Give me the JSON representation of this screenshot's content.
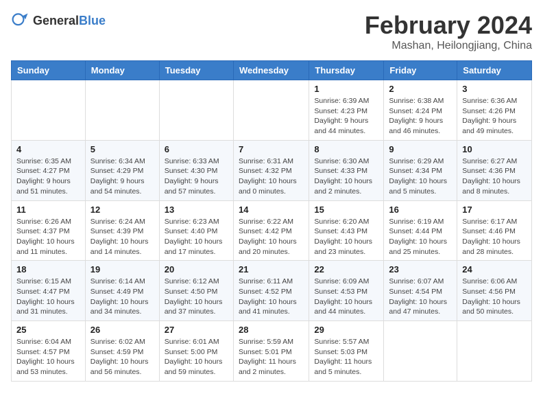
{
  "header": {
    "logo_general": "General",
    "logo_blue": "Blue",
    "month_title": "February 2024",
    "location": "Mashan, Heilongjiang, China"
  },
  "weekdays": [
    "Sunday",
    "Monday",
    "Tuesday",
    "Wednesday",
    "Thursday",
    "Friday",
    "Saturday"
  ],
  "weeks": [
    [
      {
        "day": "",
        "info": ""
      },
      {
        "day": "",
        "info": ""
      },
      {
        "day": "",
        "info": ""
      },
      {
        "day": "",
        "info": ""
      },
      {
        "day": "1",
        "info": "Sunrise: 6:39 AM\nSunset: 4:23 PM\nDaylight: 9 hours\nand 44 minutes."
      },
      {
        "day": "2",
        "info": "Sunrise: 6:38 AM\nSunset: 4:24 PM\nDaylight: 9 hours\nand 46 minutes."
      },
      {
        "day": "3",
        "info": "Sunrise: 6:36 AM\nSunset: 4:26 PM\nDaylight: 9 hours\nand 49 minutes."
      }
    ],
    [
      {
        "day": "4",
        "info": "Sunrise: 6:35 AM\nSunset: 4:27 PM\nDaylight: 9 hours\nand 51 minutes."
      },
      {
        "day": "5",
        "info": "Sunrise: 6:34 AM\nSunset: 4:29 PM\nDaylight: 9 hours\nand 54 minutes."
      },
      {
        "day": "6",
        "info": "Sunrise: 6:33 AM\nSunset: 4:30 PM\nDaylight: 9 hours\nand 57 minutes."
      },
      {
        "day": "7",
        "info": "Sunrise: 6:31 AM\nSunset: 4:32 PM\nDaylight: 10 hours\nand 0 minutes."
      },
      {
        "day": "8",
        "info": "Sunrise: 6:30 AM\nSunset: 4:33 PM\nDaylight: 10 hours\nand 2 minutes."
      },
      {
        "day": "9",
        "info": "Sunrise: 6:29 AM\nSunset: 4:34 PM\nDaylight: 10 hours\nand 5 minutes."
      },
      {
        "day": "10",
        "info": "Sunrise: 6:27 AM\nSunset: 4:36 PM\nDaylight: 10 hours\nand 8 minutes."
      }
    ],
    [
      {
        "day": "11",
        "info": "Sunrise: 6:26 AM\nSunset: 4:37 PM\nDaylight: 10 hours\nand 11 minutes."
      },
      {
        "day": "12",
        "info": "Sunrise: 6:24 AM\nSunset: 4:39 PM\nDaylight: 10 hours\nand 14 minutes."
      },
      {
        "day": "13",
        "info": "Sunrise: 6:23 AM\nSunset: 4:40 PM\nDaylight: 10 hours\nand 17 minutes."
      },
      {
        "day": "14",
        "info": "Sunrise: 6:22 AM\nSunset: 4:42 PM\nDaylight: 10 hours\nand 20 minutes."
      },
      {
        "day": "15",
        "info": "Sunrise: 6:20 AM\nSunset: 4:43 PM\nDaylight: 10 hours\nand 23 minutes."
      },
      {
        "day": "16",
        "info": "Sunrise: 6:19 AM\nSunset: 4:44 PM\nDaylight: 10 hours\nand 25 minutes."
      },
      {
        "day": "17",
        "info": "Sunrise: 6:17 AM\nSunset: 4:46 PM\nDaylight: 10 hours\nand 28 minutes."
      }
    ],
    [
      {
        "day": "18",
        "info": "Sunrise: 6:15 AM\nSunset: 4:47 PM\nDaylight: 10 hours\nand 31 minutes."
      },
      {
        "day": "19",
        "info": "Sunrise: 6:14 AM\nSunset: 4:49 PM\nDaylight: 10 hours\nand 34 minutes."
      },
      {
        "day": "20",
        "info": "Sunrise: 6:12 AM\nSunset: 4:50 PM\nDaylight: 10 hours\nand 37 minutes."
      },
      {
        "day": "21",
        "info": "Sunrise: 6:11 AM\nSunset: 4:52 PM\nDaylight: 10 hours\nand 41 minutes."
      },
      {
        "day": "22",
        "info": "Sunrise: 6:09 AM\nSunset: 4:53 PM\nDaylight: 10 hours\nand 44 minutes."
      },
      {
        "day": "23",
        "info": "Sunrise: 6:07 AM\nSunset: 4:54 PM\nDaylight: 10 hours\nand 47 minutes."
      },
      {
        "day": "24",
        "info": "Sunrise: 6:06 AM\nSunset: 4:56 PM\nDaylight: 10 hours\nand 50 minutes."
      }
    ],
    [
      {
        "day": "25",
        "info": "Sunrise: 6:04 AM\nSunset: 4:57 PM\nDaylight: 10 hours\nand 53 minutes."
      },
      {
        "day": "26",
        "info": "Sunrise: 6:02 AM\nSunset: 4:59 PM\nDaylight: 10 hours\nand 56 minutes."
      },
      {
        "day": "27",
        "info": "Sunrise: 6:01 AM\nSunset: 5:00 PM\nDaylight: 10 hours\nand 59 minutes."
      },
      {
        "day": "28",
        "info": "Sunrise: 5:59 AM\nSunset: 5:01 PM\nDaylight: 11 hours\nand 2 minutes."
      },
      {
        "day": "29",
        "info": "Sunrise: 5:57 AM\nSunset: 5:03 PM\nDaylight: 11 hours\nand 5 minutes."
      },
      {
        "day": "",
        "info": ""
      },
      {
        "day": "",
        "info": ""
      }
    ]
  ]
}
